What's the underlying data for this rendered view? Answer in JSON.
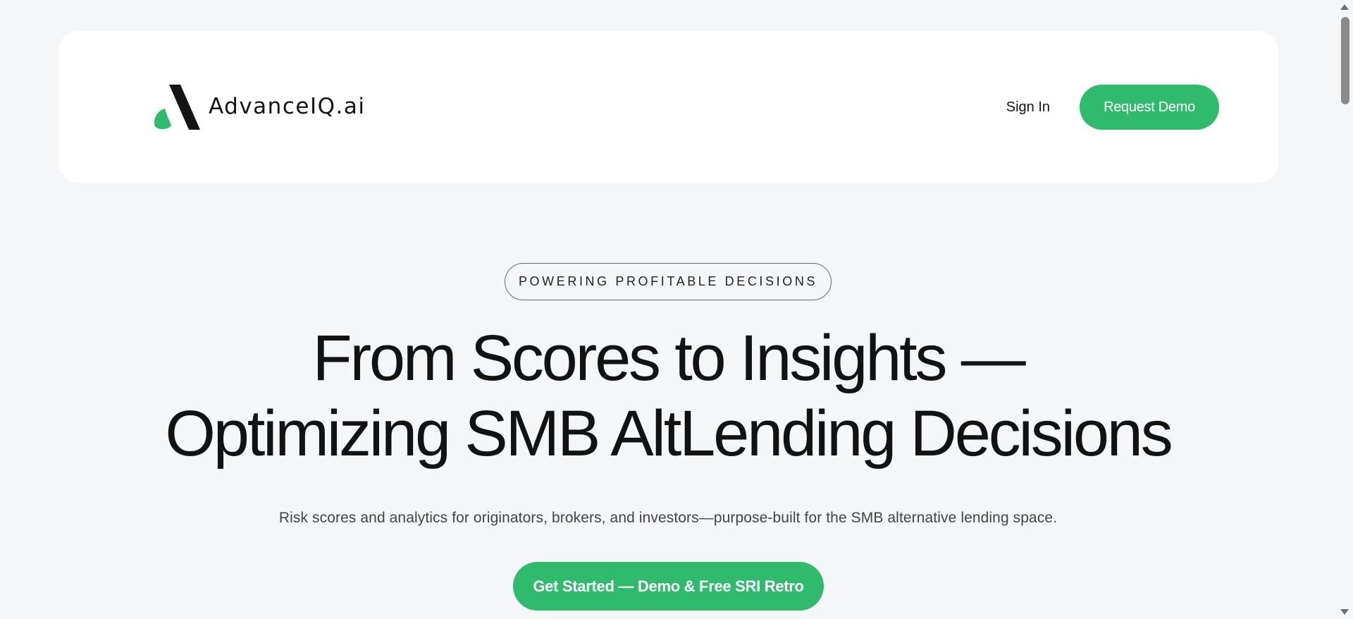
{
  "header": {
    "logo_text": "AdvanceIQ.ai",
    "sign_in_label": "Sign In",
    "request_demo_label": "Request Demo"
  },
  "hero": {
    "eyebrow": "POWERING PROFITABLE DECISIONS",
    "headline_line1": "From Scores to Insights —",
    "headline_line2": "Optimizing SMB AltLending Decisions",
    "subheadline": "Risk scores and analytics for originators, brokers, and investors—purpose-built for the SMB alternative lending space.",
    "cta_label": "Get Started — Demo & Free SRI Retro"
  },
  "colors": {
    "brand_green": "#2fba6e",
    "background": "#f5f6f8",
    "text_primary": "#121212"
  },
  "icons": {
    "logo": "advanceiq-logo-icon",
    "scroll_up": "scroll-up-arrow-icon",
    "scroll_down": "scroll-down-arrow-icon"
  }
}
